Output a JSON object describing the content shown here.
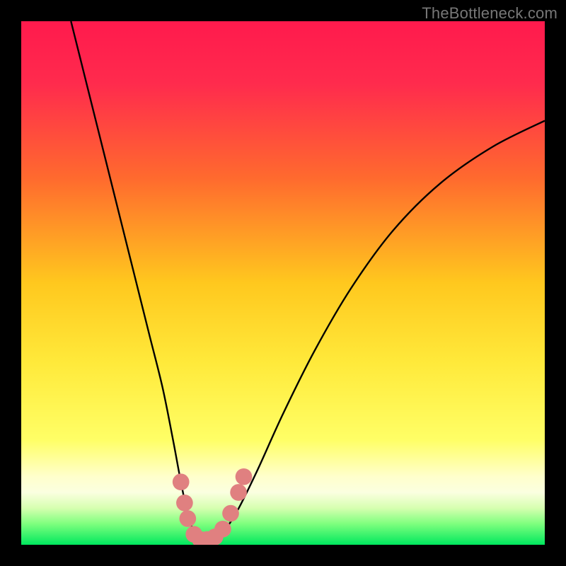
{
  "watermark": "TheBottleneck.com",
  "chart_data": {
    "type": "line",
    "title": "",
    "xlabel": "",
    "ylabel": "",
    "xlim": [
      0,
      100
    ],
    "ylim": [
      0,
      100
    ],
    "background_gradient_stops": [
      {
        "offset": 0,
        "color": "#ff1a4d"
      },
      {
        "offset": 12,
        "color": "#ff2b4d"
      },
      {
        "offset": 30,
        "color": "#ff6a2e"
      },
      {
        "offset": 50,
        "color": "#ffc81e"
      },
      {
        "offset": 65,
        "color": "#ffe93a"
      },
      {
        "offset": 80,
        "color": "#ffff66"
      },
      {
        "offset": 87,
        "color": "#ffffcc"
      },
      {
        "offset": 90,
        "color": "#fbffe0"
      },
      {
        "offset": 93,
        "color": "#d6ffb0"
      },
      {
        "offset": 96,
        "color": "#7eff7e"
      },
      {
        "offset": 100,
        "color": "#00e85e"
      }
    ],
    "series": [
      {
        "name": "left-curve",
        "description": "Bottleneck curve descending from top-left edge to the minimum",
        "points": [
          {
            "x": 9.5,
            "y": 100
          },
          {
            "x": 12,
            "y": 90
          },
          {
            "x": 14.5,
            "y": 80
          },
          {
            "x": 17,
            "y": 70
          },
          {
            "x": 19.5,
            "y": 60
          },
          {
            "x": 22,
            "y": 50
          },
          {
            "x": 24.5,
            "y": 40
          },
          {
            "x": 27,
            "y": 30
          },
          {
            "x": 29,
            "y": 20
          },
          {
            "x": 30.5,
            "y": 12
          },
          {
            "x": 32,
            "y": 5
          },
          {
            "x": 33.5,
            "y": 2
          },
          {
            "x": 35,
            "y": 1
          }
        ]
      },
      {
        "name": "right-curve",
        "description": "Bottleneck curve ascending from the minimum toward the right edge",
        "points": [
          {
            "x": 35,
            "y": 1
          },
          {
            "x": 38,
            "y": 2
          },
          {
            "x": 41,
            "y": 6
          },
          {
            "x": 45,
            "y": 14
          },
          {
            "x": 50,
            "y": 25
          },
          {
            "x": 56,
            "y": 37
          },
          {
            "x": 63,
            "y": 49
          },
          {
            "x": 71,
            "y": 60
          },
          {
            "x": 80,
            "y": 69
          },
          {
            "x": 90,
            "y": 76
          },
          {
            "x": 100,
            "y": 81
          }
        ]
      }
    ],
    "markers": {
      "name": "highlight-dots",
      "color": "#e08080",
      "radius_pct": 1.6,
      "points": [
        {
          "x": 30.5,
          "y": 12
        },
        {
          "x": 31.2,
          "y": 8
        },
        {
          "x": 31.8,
          "y": 5
        },
        {
          "x": 33.0,
          "y": 2
        },
        {
          "x": 34.2,
          "y": 1
        },
        {
          "x": 35.5,
          "y": 1
        },
        {
          "x": 37.0,
          "y": 1.5
        },
        {
          "x": 38.5,
          "y": 3
        },
        {
          "x": 40.0,
          "y": 6
        },
        {
          "x": 41.5,
          "y": 10
        },
        {
          "x": 42.5,
          "y": 13
        }
      ]
    },
    "optimal_x": 35,
    "optimal_y": 1
  }
}
